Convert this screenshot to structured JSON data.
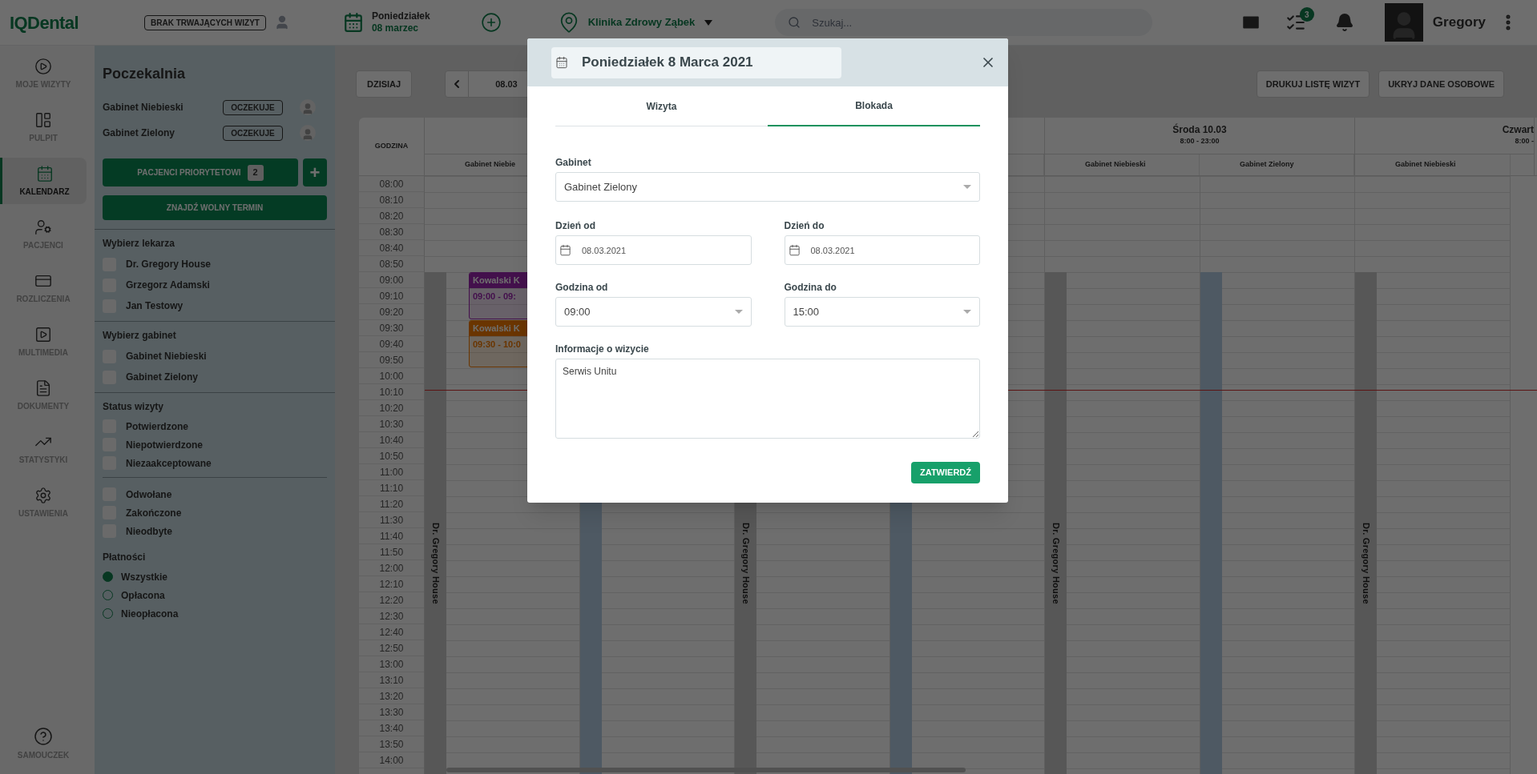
{
  "topbar": {
    "logo": "IQDental",
    "visit_status": "BRAK TRWAJĄCYCH WIZYT",
    "weekday": "Poniedziałek",
    "date": "08 marzec",
    "clinic": "Klinika Zdrowy Ząbek",
    "search": {
      "placeholder": "Szukaj..."
    },
    "tasks_badge": "3",
    "user_name": "Gregory"
  },
  "nav": {
    "items": [
      {
        "label": "MOJE WIZYTY",
        "selected": false
      },
      {
        "label": "PULPIT",
        "selected": false
      },
      {
        "label": "KALENDARZ",
        "selected": true
      },
      {
        "label": "PACJENCI",
        "selected": false
      },
      {
        "label": "ROZLICZENIA",
        "selected": false
      },
      {
        "label": "MULTIMEDIA",
        "selected": false
      },
      {
        "label": "DOKUMENTY",
        "selected": false
      },
      {
        "label": "STATYSTYKI",
        "selected": false
      },
      {
        "label": "USTAWIENIA",
        "selected": false
      }
    ],
    "help": {
      "label": "SAMOUCZEK"
    }
  },
  "sidebar": {
    "title": "Poczekalnia",
    "waiting": [
      {
        "room": "Gabinet Niebieski",
        "status": "OCZEKUJE"
      },
      {
        "room": "Gabinet Zielony",
        "status": "OCZEKUJE"
      }
    ],
    "priority_button": "PACJENCI PRIORYTETOWI",
    "priority_count": "2",
    "plus_button": "+",
    "find_button": "ZNAJDŹ WOLNY TERMIN",
    "filters": [
      {
        "title": "Wybierz lekarza",
        "items": [
          {
            "label": "Dr. Gregory House",
            "checked": false
          },
          {
            "label": "Grzegorz Adamski",
            "checked": false
          },
          {
            "label": "Jan Testowy",
            "checked": false
          }
        ]
      },
      {
        "title": "Wybierz gabinet",
        "items": [
          {
            "label": "Gabinet Niebieski",
            "checked": false
          },
          {
            "label": "Gabinet Zielony",
            "checked": false
          }
        ]
      },
      {
        "title": "Status wizyty",
        "items": [
          {
            "label": "Potwierdzone",
            "checked": false
          },
          {
            "label": "Niepotwierdzone",
            "checked": false
          },
          {
            "label": "Niezaakceptowane",
            "checked": false
          }
        ]
      },
      {
        "items": [
          {
            "label": "Odwołane",
            "checked": false
          },
          {
            "label": "Zakończone",
            "checked": false
          },
          {
            "label": "Nieodbyte",
            "checked": false
          }
        ]
      }
    ],
    "payments": {
      "title": "Płatności",
      "options": [
        {
          "label": "Wszystkie",
          "selected": true
        },
        {
          "label": "Opłacona",
          "selected": false
        },
        {
          "label": "Nieopłacona",
          "selected": false
        }
      ]
    }
  },
  "calendar": {
    "today_button": "DZISIAJ",
    "range": "08.03",
    "actions": [
      "DRUKUJ LISTĘ WIZYT",
      "UKRYJ DANE OSOBOWE"
    ],
    "time_header": "GODZINA",
    "times": [
      "08:00",
      "08:10",
      "08:20",
      "08:30",
      "08:40",
      "08:50",
      "09:00",
      "09:10",
      "09:20",
      "09:30",
      "09:40",
      "09:50",
      "10:00",
      "10:10",
      "10:20",
      "10:30",
      "10:40",
      "10:50",
      "11:00",
      "11:10",
      "11:20",
      "11:30",
      "11:40",
      "11:50",
      "12:00",
      "12:10",
      "12:20",
      "12:30",
      "12:40",
      "12:50",
      "13:00",
      "13:10",
      "13:20",
      "13:30",
      "13:40",
      "13:50",
      "14:00"
    ],
    "days": [
      {
        "rooms": [
          {
            "kind": "doctor",
            "name": "Gabinet Niebie",
            "doctor": "Dr. Gregory House",
            "appointments": [
              {
                "patient": "Kowalski K",
                "time": "09:00 - 09:"
              },
              {
                "patient": "Kowalski K",
                "time": "09:30 - 10:0"
              }
            ]
          },
          {
            "kind": "free"
          }
        ]
      },
      {
        "rooms": [
          {
            "kind": "doctor",
            "doctor": "Dr. Gregory House"
          },
          {
            "kind": "free"
          }
        ]
      },
      {
        "title": "Środa 10.03",
        "hours": "8:00 - 23:00",
        "rooms": [
          {
            "kind": "doctor",
            "name": "Gabinet Niebieski",
            "doctor": "Dr. Gregory House"
          },
          {
            "kind": "free",
            "name": "Gabinet Zielony"
          }
        ]
      },
      {
        "title": "Czwart",
        "hours": "8:00 -",
        "rooms": [
          {
            "kind": "doctor",
            "name": "Gabinet Niebieski",
            "doctor": "Dr. Gregory House"
          }
        ]
      }
    ]
  },
  "modal": {
    "title": "Poniedziałek 8 Marca 2021",
    "tabs": [
      {
        "label": "Wizyta",
        "selected": false
      },
      {
        "label": "Blokada",
        "selected": true
      }
    ],
    "room": {
      "label": "Gabinet",
      "value": "Gabinet Zielony"
    },
    "day_from": {
      "label": "Dzień od",
      "value": "08.03.2021"
    },
    "day_to": {
      "label": "Dzień do",
      "value": "08.03.2021"
    },
    "hour_from": {
      "label": "Godzina od",
      "value": "09:00"
    },
    "hour_to": {
      "label": "Godzina do",
      "value": "15:00"
    },
    "info": {
      "label": "Informacje o wizycie",
      "value": "Serwis Unitu"
    },
    "submit": "ZATWIERDŹ"
  }
}
